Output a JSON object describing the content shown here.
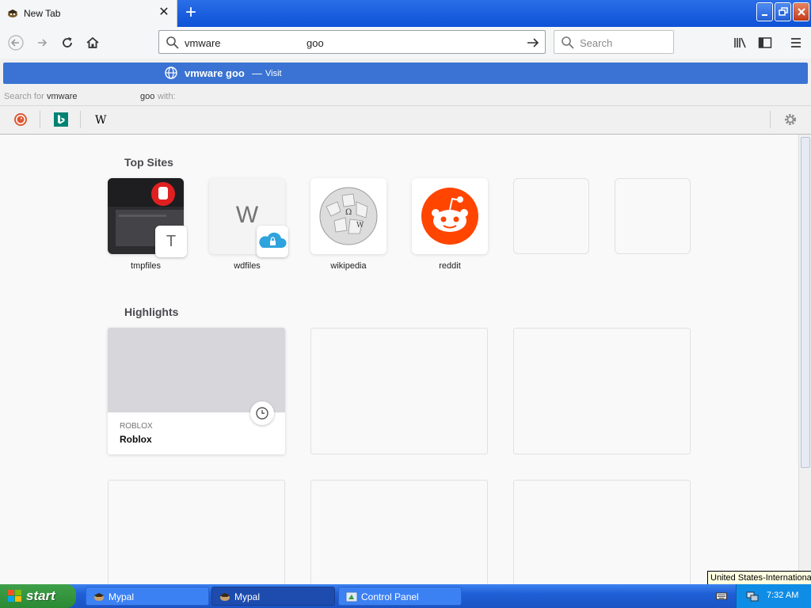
{
  "tab": {
    "title": "New Tab",
    "close_glyph": "✕",
    "new_tab_glyph": "+"
  },
  "navbar": {
    "url_value_part1": "vmware",
    "url_value_part2": "goo",
    "search_placeholder": "Search"
  },
  "popup": {
    "suggestion_title": "vmware goo",
    "suggestion_dash": "—",
    "suggestion_action": "Visit",
    "search_for_label": "Search for",
    "search_for_query1": "vmware",
    "search_for_query2": "goo",
    "search_with_label": "with:",
    "engines": [
      "duckduckgo-icon",
      "bing-icon",
      "wikipedia-icon"
    ]
  },
  "content": {
    "top_sites_title": "Top Sites",
    "top_sites": [
      {
        "label": "tmpfiles",
        "overlay_letter": "T"
      },
      {
        "label": "wdfiles",
        "letter": "W"
      },
      {
        "label": "wikipedia"
      },
      {
        "label": "reddit"
      },
      {
        "label": ""
      },
      {
        "label": ""
      }
    ],
    "highlights_title": "Highlights",
    "highlights": [
      {
        "source": "ROBLOX",
        "title": "Roblox"
      }
    ]
  },
  "taskbar": {
    "start_label": "start",
    "tasks": [
      {
        "label": "Mypal",
        "active": false
      },
      {
        "label": "Mypal",
        "active": true
      },
      {
        "label": "Control Panel",
        "active": false
      }
    ],
    "clock": "7:32 AM",
    "tooltip": "United States-International"
  },
  "colors": {
    "accent": "#3a73d3",
    "title_bar": "#0d52d6",
    "reddit": "#ff4500",
    "taskbar": "#1f5fd6"
  }
}
